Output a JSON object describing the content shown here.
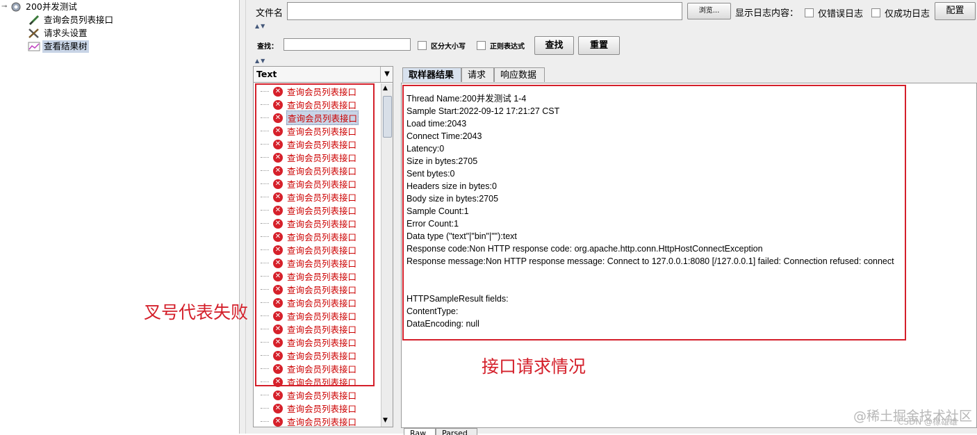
{
  "tree": {
    "root": "200并发测试",
    "children": [
      "查询会员列表接口",
      "请求头设置",
      "查看结果树"
    ]
  },
  "toolbar": {
    "filename_label": "文件名",
    "browse_label": "浏览...",
    "log_label": "显示日志内容：",
    "errors_only": "仅错误日志",
    "success_only": "仅成功日志",
    "config_label": "配置"
  },
  "search": {
    "label": "查找：",
    "case_label": "区分大小写",
    "regex_label": "正则表达式",
    "find_label": "查找",
    "reset_label": "重置"
  },
  "list": {
    "combo_value": "Text",
    "item_label": "查询会员列表接口"
  },
  "tabs": [
    "取样器结果",
    "请求",
    "响应数据"
  ],
  "result_lines": [
    "Thread Name:200并发测试 1-4",
    "Sample Start:2022-09-12 17:21:27 CST",
    "Load time:2043",
    "Connect Time:2043",
    "Latency:0",
    "Size in bytes:2705",
    "Sent bytes:0",
    "Headers size in bytes:0",
    "Body size in bytes:2705",
    "Sample Count:1",
    "Error Count:1",
    "Data type (\"text\"|\"bin\"|\"\"):text",
    "Response code:Non HTTP response code: org.apache.http.conn.HttpHostConnectException",
    "Response message:Non HTTP response message: Connect to 127.0.0.1:8080 [/127.0.0.1] failed: Connection refused: connect",
    "",
    "",
    "HTTPSampleResult fields:",
    "ContentType:",
    "DataEncoding: null"
  ],
  "bottom_tabs": [
    "Raw",
    "Parsed"
  ],
  "annotations": {
    "fail_note": "叉号代表失败",
    "request_note": "接口请求情况"
  },
  "watermark": {
    "line1": "@稀土掘金技术社区",
    "line2": "CSDN @橡雄雄"
  },
  "colors": {
    "annotation_red": "#d41f2a",
    "error_text": "#cc0000",
    "selection": "#c8d4e6"
  }
}
